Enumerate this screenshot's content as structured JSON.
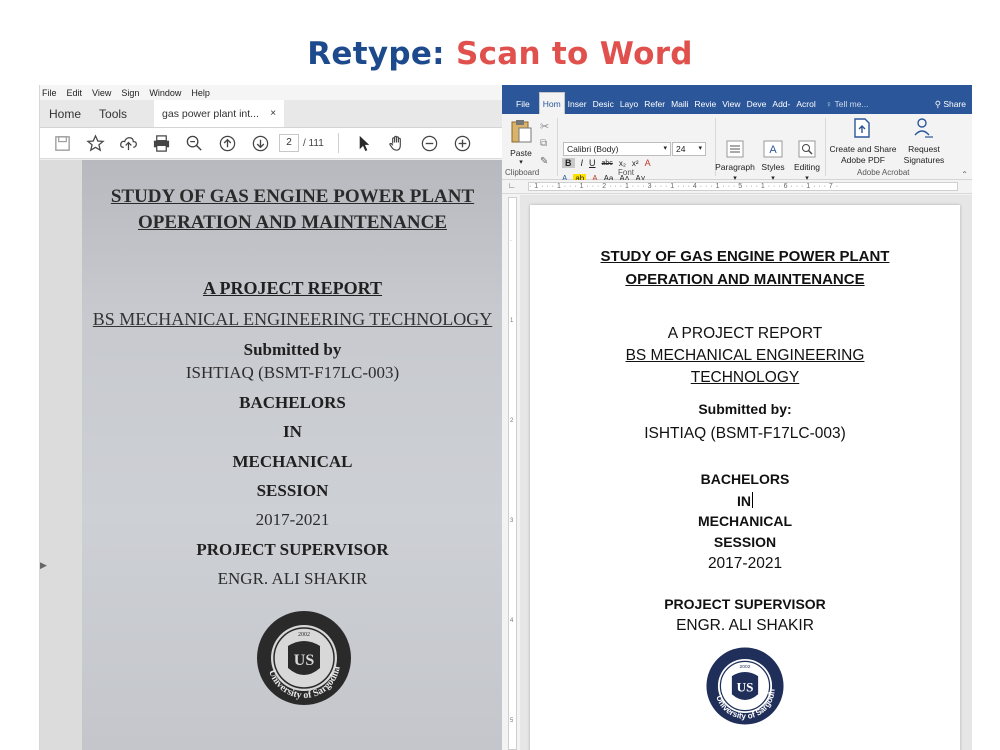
{
  "banner": {
    "prefix": "Retype:",
    "rest": "Scan to Word"
  },
  "pdf_viewer": {
    "menu": [
      "File",
      "Edit",
      "View",
      "Sign",
      "Window",
      "Help"
    ],
    "tabs": {
      "home": "Home",
      "tools": "Tools",
      "document": "gas power plant int...",
      "close": "×"
    },
    "page": {
      "current": "2",
      "total": "/ 111"
    },
    "scan": {
      "title_line1": "STUDY OF GAS ENGINE POWER PLANT",
      "title_line2": "OPERATION AND MAINTENANCE",
      "report": "A PROJECT REPORT",
      "program": "BS MECHANICAL ENGINEERING TECHNOLOGY",
      "submitted_by": "Submitted by",
      "student": "ISHTIAQ (BSMT-F17LC-003)",
      "bachelors": "BACHELORS",
      "in": "IN",
      "mechanical": "MECHANICAL",
      "session": "SESSION",
      "years": "2017-2021",
      "supervisor_label": "PROJECT SUPERVISOR",
      "supervisor_name": "ENGR. ALI SHAKIR",
      "seal_text": "University of Sargodha",
      "seal_year": "2002"
    }
  },
  "word": {
    "tabs": [
      "File",
      "Hom",
      "Inser",
      "Desic",
      "Layo",
      "Refer",
      "Maili",
      "Revie",
      "View",
      "Deve",
      "Add-",
      "Acrol"
    ],
    "active_tab": "Hom",
    "tell_me": "Tell me...",
    "share": "Share",
    "ribbon": {
      "paste": "Paste",
      "font_name": "Calibri (Body)",
      "font_size": "24",
      "paragraph": "Paragraph",
      "styles": "Styles",
      "editing": "Editing",
      "create_share": "Create and Share",
      "adobe_pdf": "Adobe PDF",
      "request": "Request",
      "signatures": "Signatures",
      "groups": {
        "clipboard": "Clipboard",
        "font": "Font",
        "acrobat": "Adobe Acrobat"
      }
    },
    "ruler_text": "· 1 · · · 1 · · · 1 · · · 2 · · · 1 · · · 3 · · · 1 · · · 4 · · · 1 · · · 5 · · · 1 · · · 6 · · · 1 · · · 7 ·",
    "document": {
      "title_line1": "STUDY OF GAS ENGINE POWER PLANT",
      "title_line2": "OPERATION AND MAINTENANCE",
      "report": "A PROJECT REPORT",
      "program_line1": "BS MECHANICAL ENGINEERING",
      "program_line2": "TECHNOLOGY",
      "submitted_by": "Submitted by:",
      "student": "ISHTIAQ (BSMT-F17LC-003)",
      "bachelors": "BACHELORS",
      "in": "IN",
      "mechanical": "MECHANICAL",
      "session": "SESSION",
      "years": "2017-2021",
      "supervisor_label": "PROJECT SUPERVISOR",
      "supervisor_name": "ENGR. ALI SHAKIR",
      "seal_text": "University of Sargodha",
      "seal_year": "2002"
    }
  }
}
